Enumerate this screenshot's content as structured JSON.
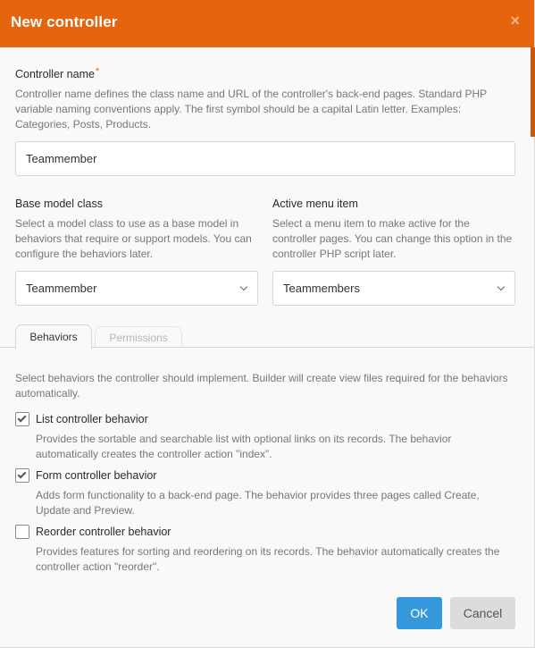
{
  "dialog": {
    "title": "New controller",
    "close_glyph": "×"
  },
  "controller_name": {
    "label": "Controller name",
    "required_mark": "*",
    "help": "Controller name defines the class name and URL of the controller's back-end pages. Standard PHP variable naming conventions apply. The first symbol should be a capital Latin letter. Examples: Categories, Posts, Products.",
    "value": "Teammember"
  },
  "base_model": {
    "label": "Base model class",
    "help": "Select a model class to use as a base model in behaviors that require or support models. You can configure the behaviors later.",
    "value": "Teammember"
  },
  "active_menu": {
    "label": "Active menu item",
    "help": "Select a menu item to make active for the controller pages. You can change this option in the controller PHP script later.",
    "value": "Teammembers"
  },
  "tabs": [
    {
      "label": "Behaviors",
      "active": true
    },
    {
      "label": "Permissions",
      "active": false
    }
  ],
  "behaviors": {
    "intro": "Select behaviors the controller should implement. Builder will create view files required for the behaviors automatically.",
    "items": [
      {
        "label": "List controller behavior",
        "checked": true,
        "desc": "Provides the sortable and searchable list with optional links on its records. The behavior automatically creates the controller action \"index\"."
      },
      {
        "label": "Form controller behavior",
        "checked": true,
        "desc": "Adds form functionality to a back-end page. The behavior provides three pages called Create, Update and Preview."
      },
      {
        "label": "Reorder controller behavior",
        "checked": false,
        "desc": "Provides features for sorting and reordering on its records. The behavior automatically creates the controller action \"reorder\"."
      }
    ]
  },
  "buttons": {
    "ok": "OK",
    "cancel": "Cancel"
  },
  "colors": {
    "header": "#e5640e",
    "primary": "#3498db",
    "cancel": "#dcdcdc"
  }
}
